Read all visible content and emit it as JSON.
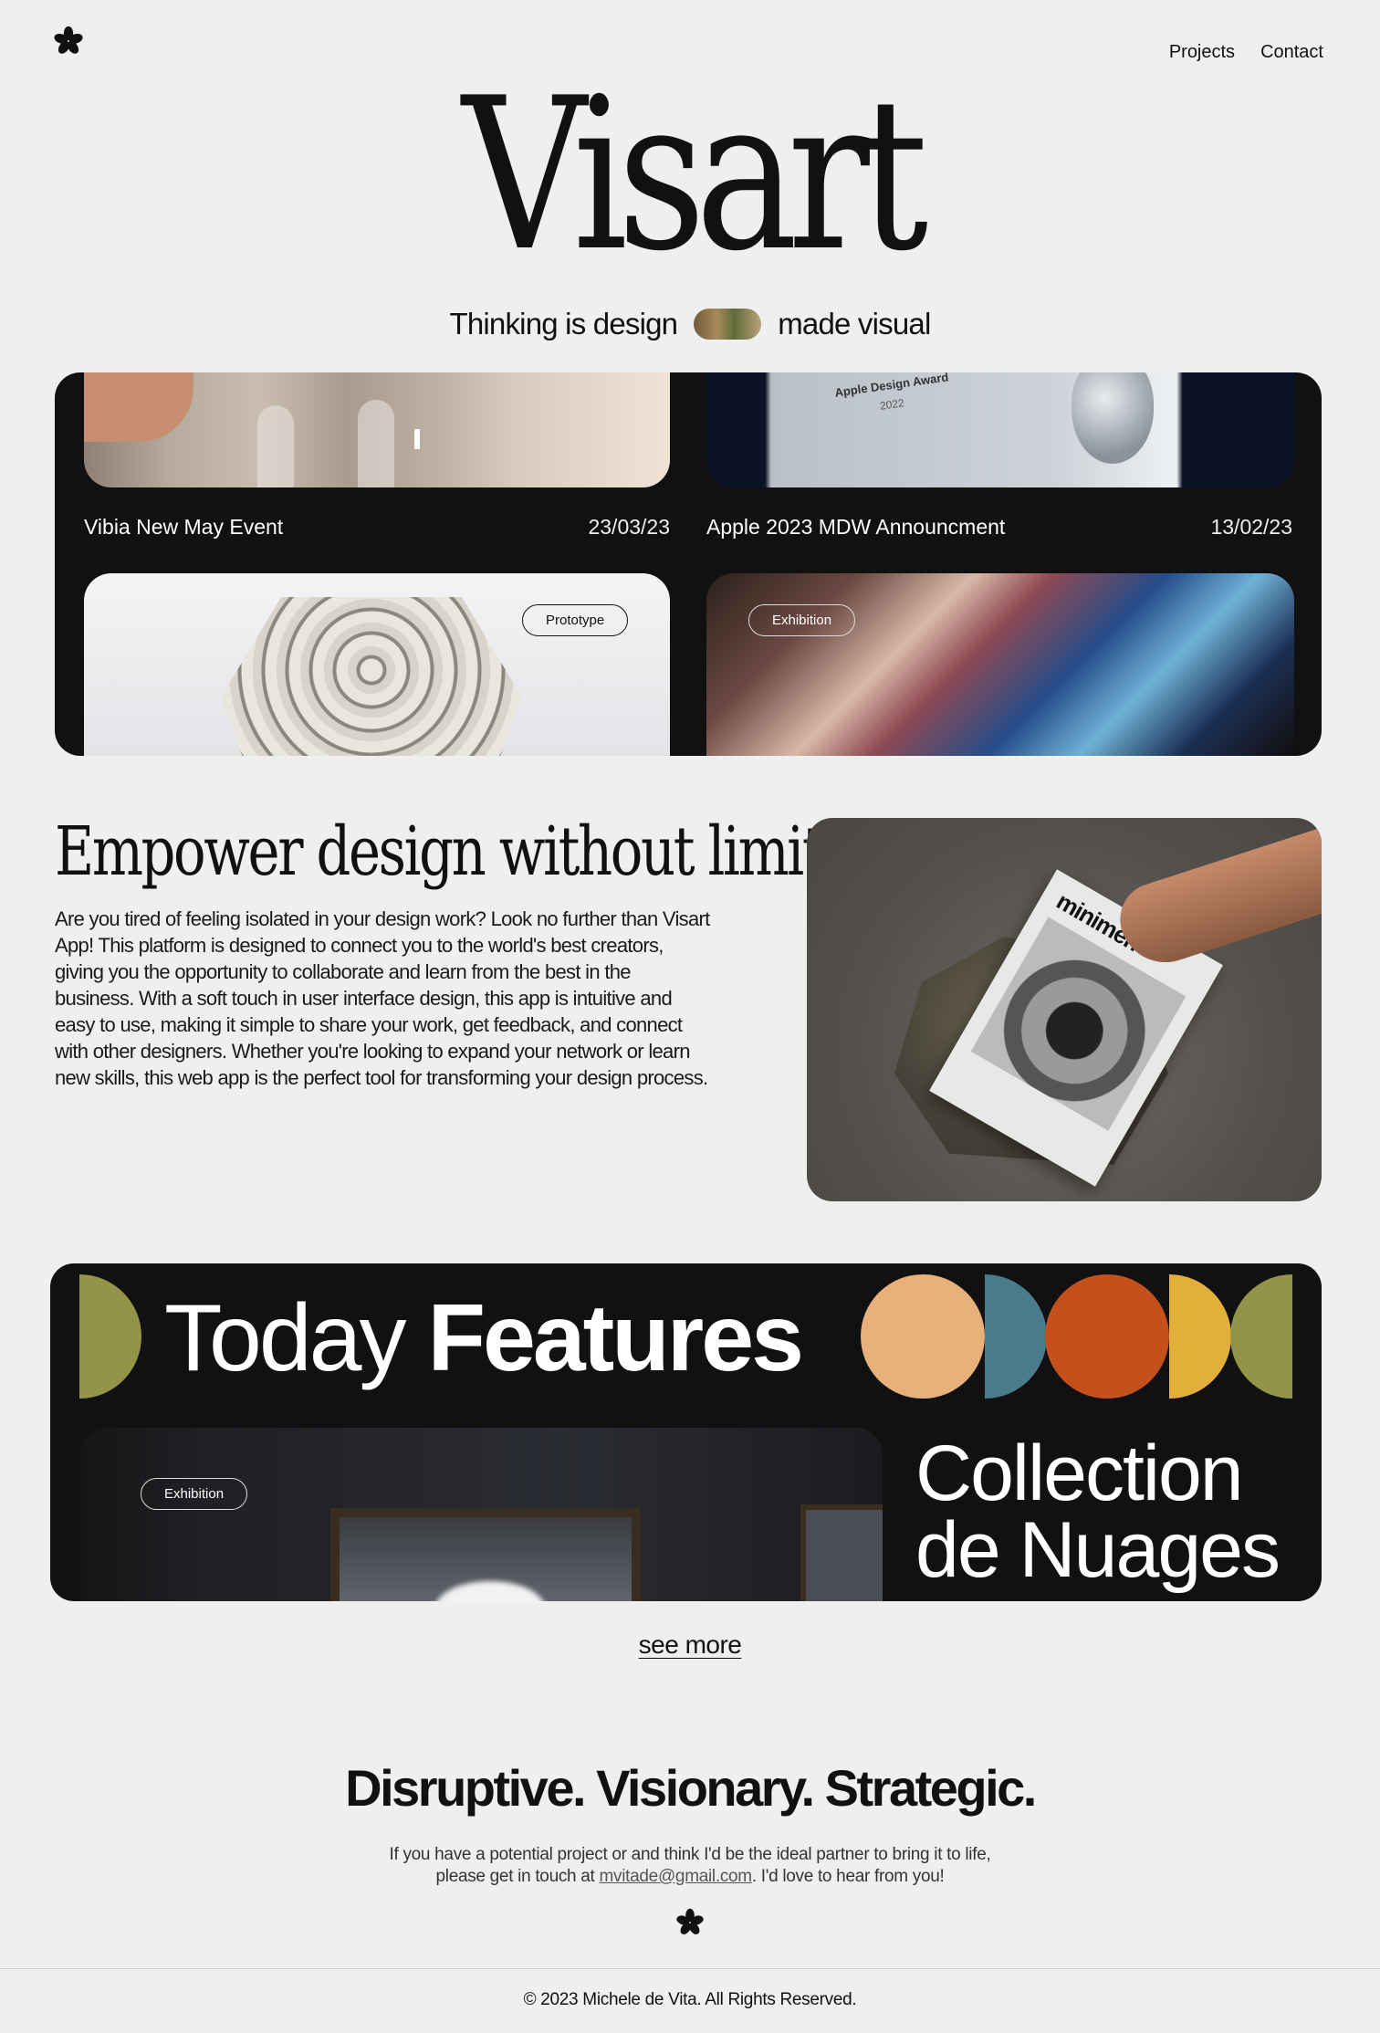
{
  "header": {
    "logo_icon": "flower-asterisk-icon",
    "nav": [
      {
        "label": "Projects"
      },
      {
        "label": "Contact"
      }
    ]
  },
  "hero": {
    "brand": "Visart",
    "tagline_before": "Thinking is design",
    "tagline_after": "made visual"
  },
  "projects": [
    {
      "title": "Vibia New May Event",
      "date": "23/03/23"
    },
    {
      "title": "Apple 2023 MDW Announcment",
      "date": "13/02/23",
      "image_text": "Apple Design Award",
      "image_year": "2022"
    },
    {
      "tag": "Prototype"
    },
    {
      "tag": "Exhibition"
    }
  ],
  "empower": {
    "title": "Empower design without limits",
    "body": "Are you tired of feeling isolated in your design work? Look no further than Visart App! This platform is designed to connect you to the world's best creators, giving you the opportunity to collaborate and learn from the best in the business. With a soft touch in user interface design, this app is intuitive and easy to use, making it simple to share your work, get feedback, and connect with other designers. Whether you're looking to expand your network or learn new skills, this web app is the perfect tool for transforming your design process.",
    "magazine_title": "minimen"
  },
  "features": {
    "title_light": "Today",
    "title_bold": "Features",
    "tag": "Exhibition",
    "collection_line1": "Collection",
    "collection_line2": "de Nuages",
    "colors": {
      "olive": "#949449",
      "peach": "#e8b07a",
      "teal": "#4a7b8c",
      "orange": "#c4501c",
      "yellow": "#e2af3a"
    }
  },
  "see_more": "see more",
  "cta": {
    "headline": "Disruptive. Visionary. Strategic.",
    "line1": "If you have a potential project or and think I'd be the ideal partner to bring it to life,",
    "line2_before": "please get in touch at ",
    "email": "mvitade@gmail.com",
    "line2_after": ". I'd love to hear from you!"
  },
  "footer": {
    "copyright": "© 2023 Michele de Vita. All Rights Reserved."
  }
}
